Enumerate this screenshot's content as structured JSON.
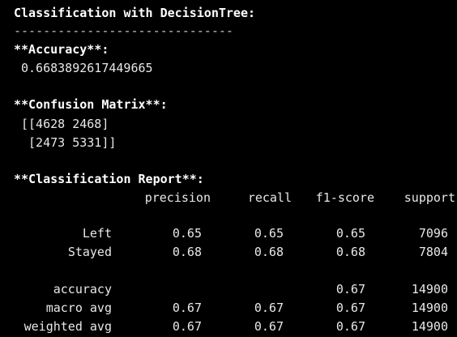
{
  "title": "Classification with DecisionTree:",
  "separator": "------------------------------",
  "accuracy": {
    "heading": "**Accuracy**:",
    "value": "0.6683892617449665"
  },
  "confusion": {
    "heading": "**Confusion Matrix**:",
    "row1": "[[4628 2468]",
    "row2": " [2473 5331]]"
  },
  "report": {
    "heading": "**Classification Report**:",
    "headers": [
      "precision",
      "recall",
      "f1-score",
      "support"
    ],
    "rows": [
      {
        "label": "Left",
        "precision": "0.65",
        "recall": "0.65",
        "f1": "0.65",
        "support": "7096"
      },
      {
        "label": "Stayed",
        "precision": "0.68",
        "recall": "0.68",
        "f1": "0.68",
        "support": "7804"
      },
      {
        "label": "accuracy",
        "precision": "",
        "recall": "",
        "f1": "0.67",
        "support": "14900"
      },
      {
        "label": "macro avg",
        "precision": "0.67",
        "recall": "0.67",
        "f1": "0.67",
        "support": "14900"
      },
      {
        "label": "weighted avg",
        "precision": "0.67",
        "recall": "0.67",
        "f1": "0.67",
        "support": "14900"
      }
    ]
  }
}
